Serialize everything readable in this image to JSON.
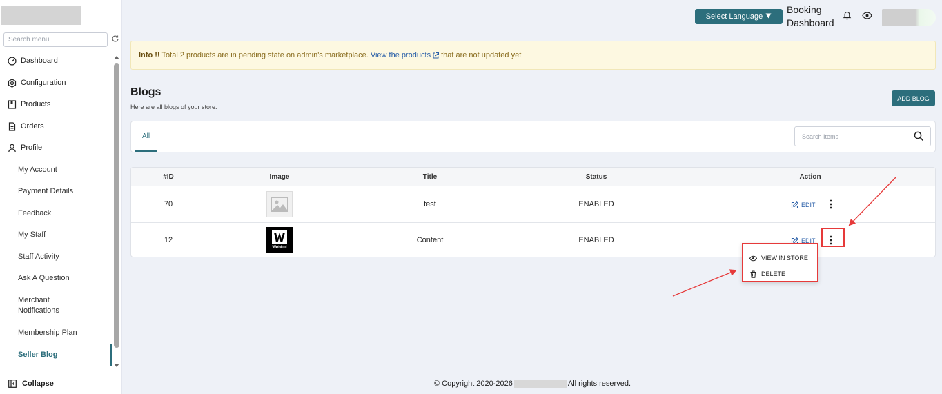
{
  "sidebar": {
    "search_placeholder": "Search menu",
    "items": [
      {
        "label": "Dashboard",
        "icon": "dashboard-icon"
      },
      {
        "label": "Configuration",
        "icon": "settings-icon"
      },
      {
        "label": "Products",
        "icon": "book-icon"
      },
      {
        "label": "Orders",
        "icon": "document-icon"
      },
      {
        "label": "Profile",
        "icon": "user-icon"
      }
    ],
    "submenu": [
      "My Account",
      "Payment Details",
      "Feedback",
      "My Staff",
      "Staff Activity",
      "Ask A Question",
      "Merchant Notifications",
      "Membership Plan",
      "Seller Blog"
    ],
    "active_submenu": "Seller Blog",
    "collapse_label": "Collapse"
  },
  "header": {
    "language_label": "Select Language",
    "title": "Booking Dashboard"
  },
  "info": {
    "prefix": "Info !!",
    "message": "Total 2 products are in pending state on admin's marketplace.",
    "link_text": "View the products",
    "suffix": "that are not updated yet"
  },
  "page": {
    "title": "Blogs",
    "subtitle": "Here are all blogs of your store.",
    "add_button": "ADD BLOG"
  },
  "tabs": {
    "all_label": "All",
    "search_placeholder": "Search Items"
  },
  "table": {
    "columns": [
      "#ID",
      "Image",
      "Title",
      "Status",
      "Action"
    ],
    "rows": [
      {
        "id": "70",
        "image": "placeholder-image",
        "title": "test",
        "status": "ENABLED",
        "edit": "EDIT"
      },
      {
        "id": "12",
        "image": "webkul-logo",
        "image_text": "Webkul",
        "title": "Content",
        "status": "ENABLED",
        "edit": "EDIT"
      }
    ]
  },
  "dropdown": {
    "items": [
      {
        "label": "VIEW IN STORE",
        "icon": "eye-icon"
      },
      {
        "label": "DELETE",
        "icon": "trash-icon"
      }
    ]
  },
  "footer": {
    "prefix": "© Copyright 2020-2026",
    "suffix": "All rights reserved."
  },
  "colors": {
    "primary": "#2c6e7c",
    "annotation": "#e63a3a",
    "info_bg": "#fdf8e1",
    "link": "#2a5fa8"
  }
}
